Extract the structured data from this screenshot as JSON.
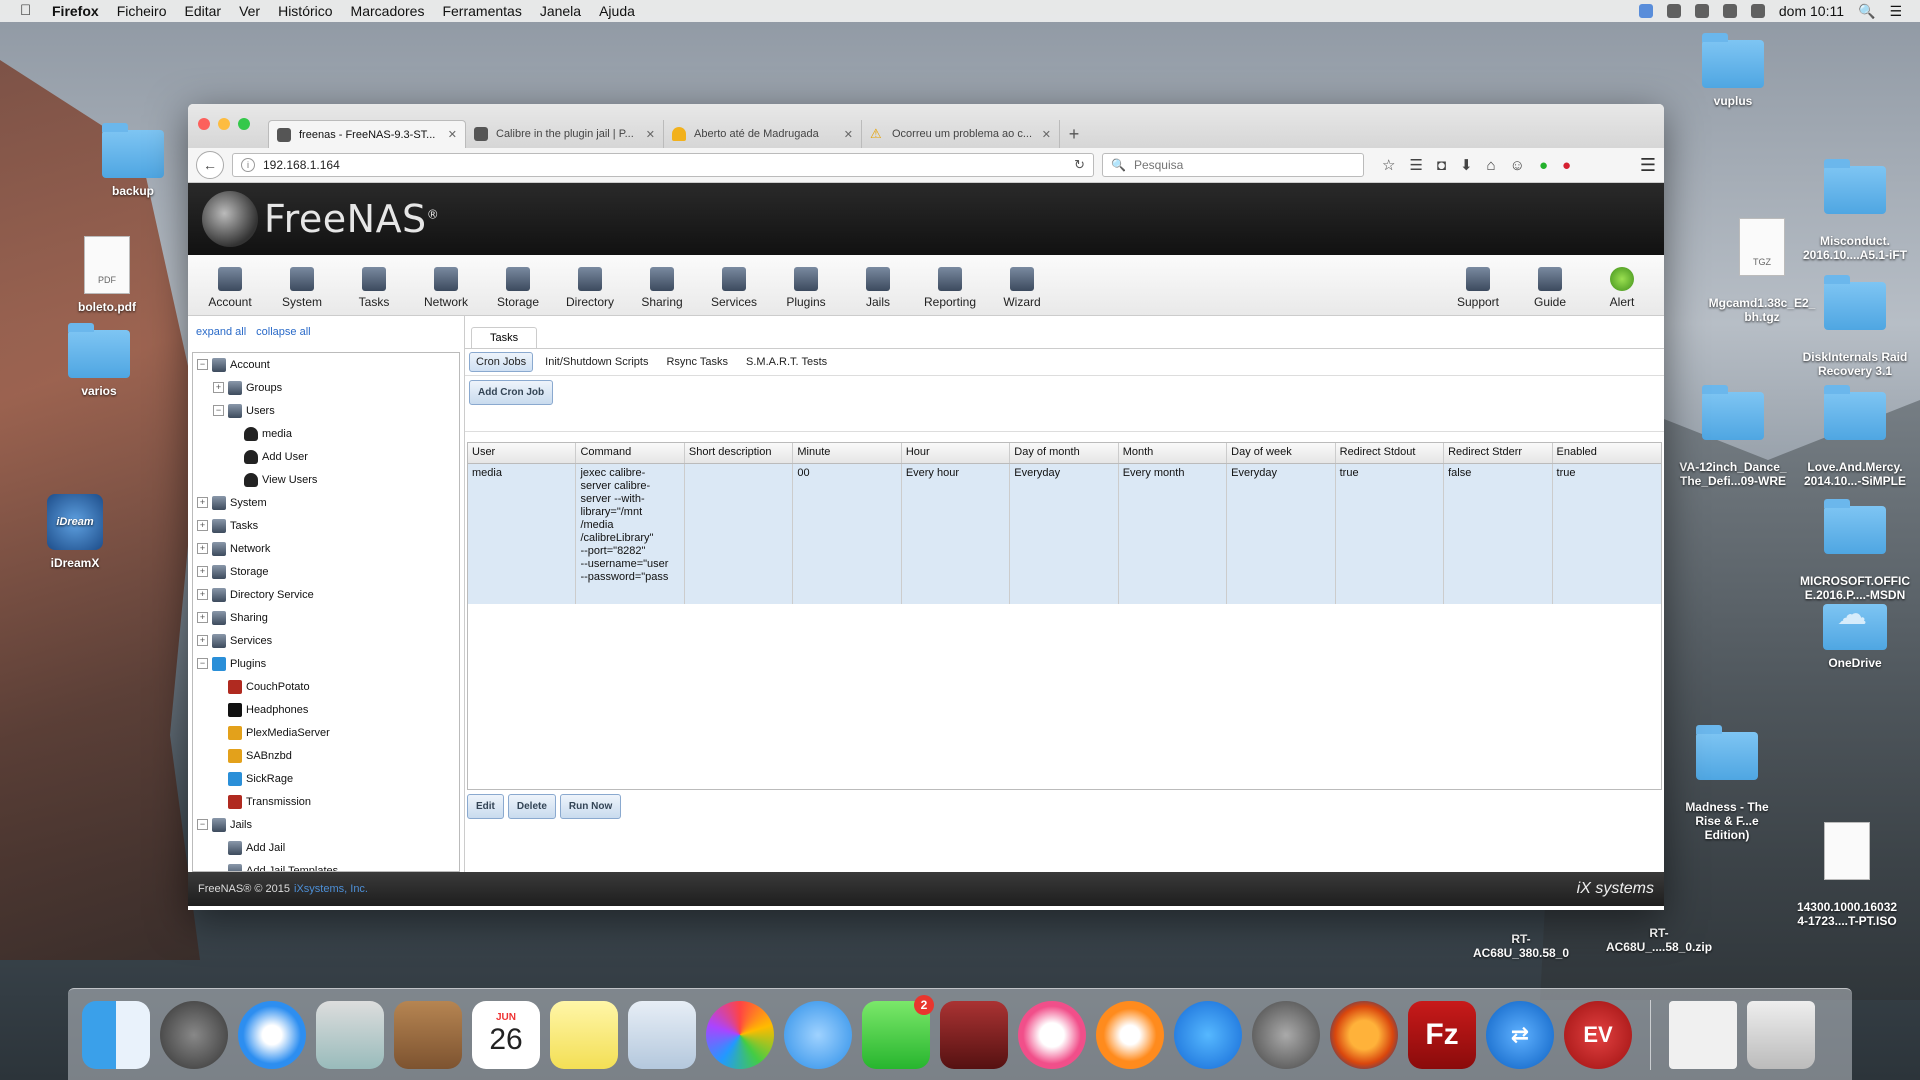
{
  "menubar": {
    "app_name": "Firefox",
    "items": [
      "Ficheiro",
      "Editar",
      "Ver",
      "Histórico",
      "Marcadores",
      "Ferramentas",
      "Janela",
      "Ajuda"
    ],
    "clock": "dom 10:11"
  },
  "desktop": {
    "icons": {
      "backup": "backup",
      "boleto": "boleto.pdf",
      "boleto_tag": "PDF",
      "varios": "varios",
      "idreamx": "iDreamX",
      "idreamx_logo": "iDream",
      "vuplus": "vuplus",
      "misconduct": "Misconduct.\n2016.10....A5.1-iFT",
      "mgcamd": "Mgcamd1.38c_E2_\nbh.tgz",
      "mgcamd_tag": "TGZ",
      "diskinternals": "DiskInternals Raid\nRecovery 3.1",
      "va12inch": "VA-12inch_Dance_\nThe_Defi...09-WRE",
      "loveandmercy": "Love.And.Mercy.\n2014.10...-SiMPLE",
      "msoffice": "MICROSOFT.OFFIC\nE.2016.P....-MSDN",
      "onedrive": "OneDrive",
      "madness": "Madness - The\nRise & F...e Edition)",
      "iso": "14300.1000.16032\n4-1723....T-PT.ISO",
      "rt1": "RT-\nAC68U_380.58_0",
      "rt2": "RT-\nAC68U_....58_0.zip"
    }
  },
  "browser": {
    "tabs": [
      {
        "title": "freenas - FreeNAS-9.3-ST...",
        "active": true
      },
      {
        "title": "Calibre in the plugin jail | P...",
        "active": false
      },
      {
        "title": "Aberto até de Madrugada",
        "active": false
      },
      {
        "title": "Ocorreu um problema ao c...",
        "active": false
      }
    ],
    "url": "192.168.1.164",
    "search_placeholder": "Pesquisa"
  },
  "freenas": {
    "logo_text": "FreeNAS",
    "toolbar": [
      {
        "label": "Account",
        "icon": "account-icon"
      },
      {
        "label": "System",
        "icon": "system-icon"
      },
      {
        "label": "Tasks",
        "icon": "tasks-icon"
      },
      {
        "label": "Network",
        "icon": "network-icon"
      },
      {
        "label": "Storage",
        "icon": "storage-icon"
      },
      {
        "label": "Directory",
        "icon": "directory-icon"
      },
      {
        "label": "Sharing",
        "icon": "sharing-icon"
      },
      {
        "label": "Services",
        "icon": "services-icon"
      },
      {
        "label": "Plugins",
        "icon": "plugins-icon"
      },
      {
        "label": "Jails",
        "icon": "jails-icon"
      },
      {
        "label": "Reporting",
        "icon": "reporting-icon"
      },
      {
        "label": "Wizard",
        "icon": "wizard-icon"
      }
    ],
    "toolbar_right": [
      {
        "label": "Support",
        "icon": "support-icon"
      },
      {
        "label": "Guide",
        "icon": "guide-icon"
      },
      {
        "label": "Alert",
        "icon": "alert-icon"
      }
    ],
    "sidebar": {
      "expand_all": "expand all",
      "collapse_all": "collapse all",
      "tree": [
        {
          "label": "Account",
          "level": 0,
          "exp": "−",
          "icon": "account"
        },
        {
          "label": "Groups",
          "level": 1,
          "exp": "+",
          "icon": "groups"
        },
        {
          "label": "Users",
          "level": 1,
          "exp": "−",
          "icon": "users"
        },
        {
          "label": "media",
          "level": 2,
          "exp": "",
          "icon": "person"
        },
        {
          "label": "Add User",
          "level": 2,
          "exp": "",
          "icon": "person"
        },
        {
          "label": "View Users",
          "level": 2,
          "exp": "",
          "icon": "person"
        },
        {
          "label": "System",
          "level": 0,
          "exp": "+",
          "icon": "system"
        },
        {
          "label": "Tasks",
          "level": 0,
          "exp": "+",
          "icon": "tasks"
        },
        {
          "label": "Network",
          "level": 0,
          "exp": "+",
          "icon": "network"
        },
        {
          "label": "Storage",
          "level": 0,
          "exp": "+",
          "icon": "storage"
        },
        {
          "label": "Directory Service",
          "level": 0,
          "exp": "+",
          "icon": "directory"
        },
        {
          "label": "Sharing",
          "level": 0,
          "exp": "+",
          "icon": "sharing"
        },
        {
          "label": "Services",
          "level": 0,
          "exp": "+",
          "icon": "services"
        },
        {
          "label": "Plugins",
          "level": 0,
          "exp": "−",
          "icon": "plug"
        },
        {
          "label": "CouchPotato",
          "level": 1,
          "exp": "",
          "icon": "red"
        },
        {
          "label": "Headphones",
          "level": 1,
          "exp": "",
          "icon": "black"
        },
        {
          "label": "PlexMediaServer",
          "level": 1,
          "exp": "",
          "icon": "yellow"
        },
        {
          "label": "SABnzbd",
          "level": 1,
          "exp": "",
          "icon": "yellow"
        },
        {
          "label": "SickRage",
          "level": 1,
          "exp": "",
          "icon": "plug"
        },
        {
          "label": "Transmission",
          "level": 1,
          "exp": "",
          "icon": "red"
        },
        {
          "label": "Jails",
          "level": 0,
          "exp": "−",
          "icon": "jails"
        },
        {
          "label": "Add Jail",
          "level": 1,
          "exp": "",
          "icon": "jails"
        },
        {
          "label": "Add Jail Templates",
          "level": 1,
          "exp": "",
          "icon": "jails"
        }
      ]
    },
    "main": {
      "top_tab": "Tasks",
      "sub_tabs": [
        "Cron Jobs",
        "Init/Shutdown Scripts",
        "Rsync Tasks",
        "S.M.A.R.T. Tests"
      ],
      "add_button": "Add Cron Job",
      "columns": [
        "User",
        "Command",
        "Short description",
        "Minute",
        "Hour",
        "Day of month",
        "Month",
        "Day of week",
        "Redirect Stdout",
        "Redirect Stderr",
        "Enabled"
      ],
      "rows": [
        [
          "media",
          "jexec calibre-\nserver calibre-\nserver --with-\nlibrary=\"/mnt\n/media\n/calibreLibrary\"\n--port=\"8282\"\n--username=\"user\n--password=\"pass",
          "",
          "00",
          "Every hour",
          "Everyday",
          "Every month",
          "Everyday",
          "true",
          "false",
          "true"
        ]
      ],
      "actions": [
        "Edit",
        "Delete",
        "Run Now"
      ]
    },
    "footer": {
      "copyright": "FreeNAS® © 2015",
      "company": "iXsystems, Inc.",
      "brand": "iX systems"
    }
  },
  "dock": {
    "calendar_month": "JUN",
    "calendar_day": "26",
    "facetime_badge": "2"
  }
}
